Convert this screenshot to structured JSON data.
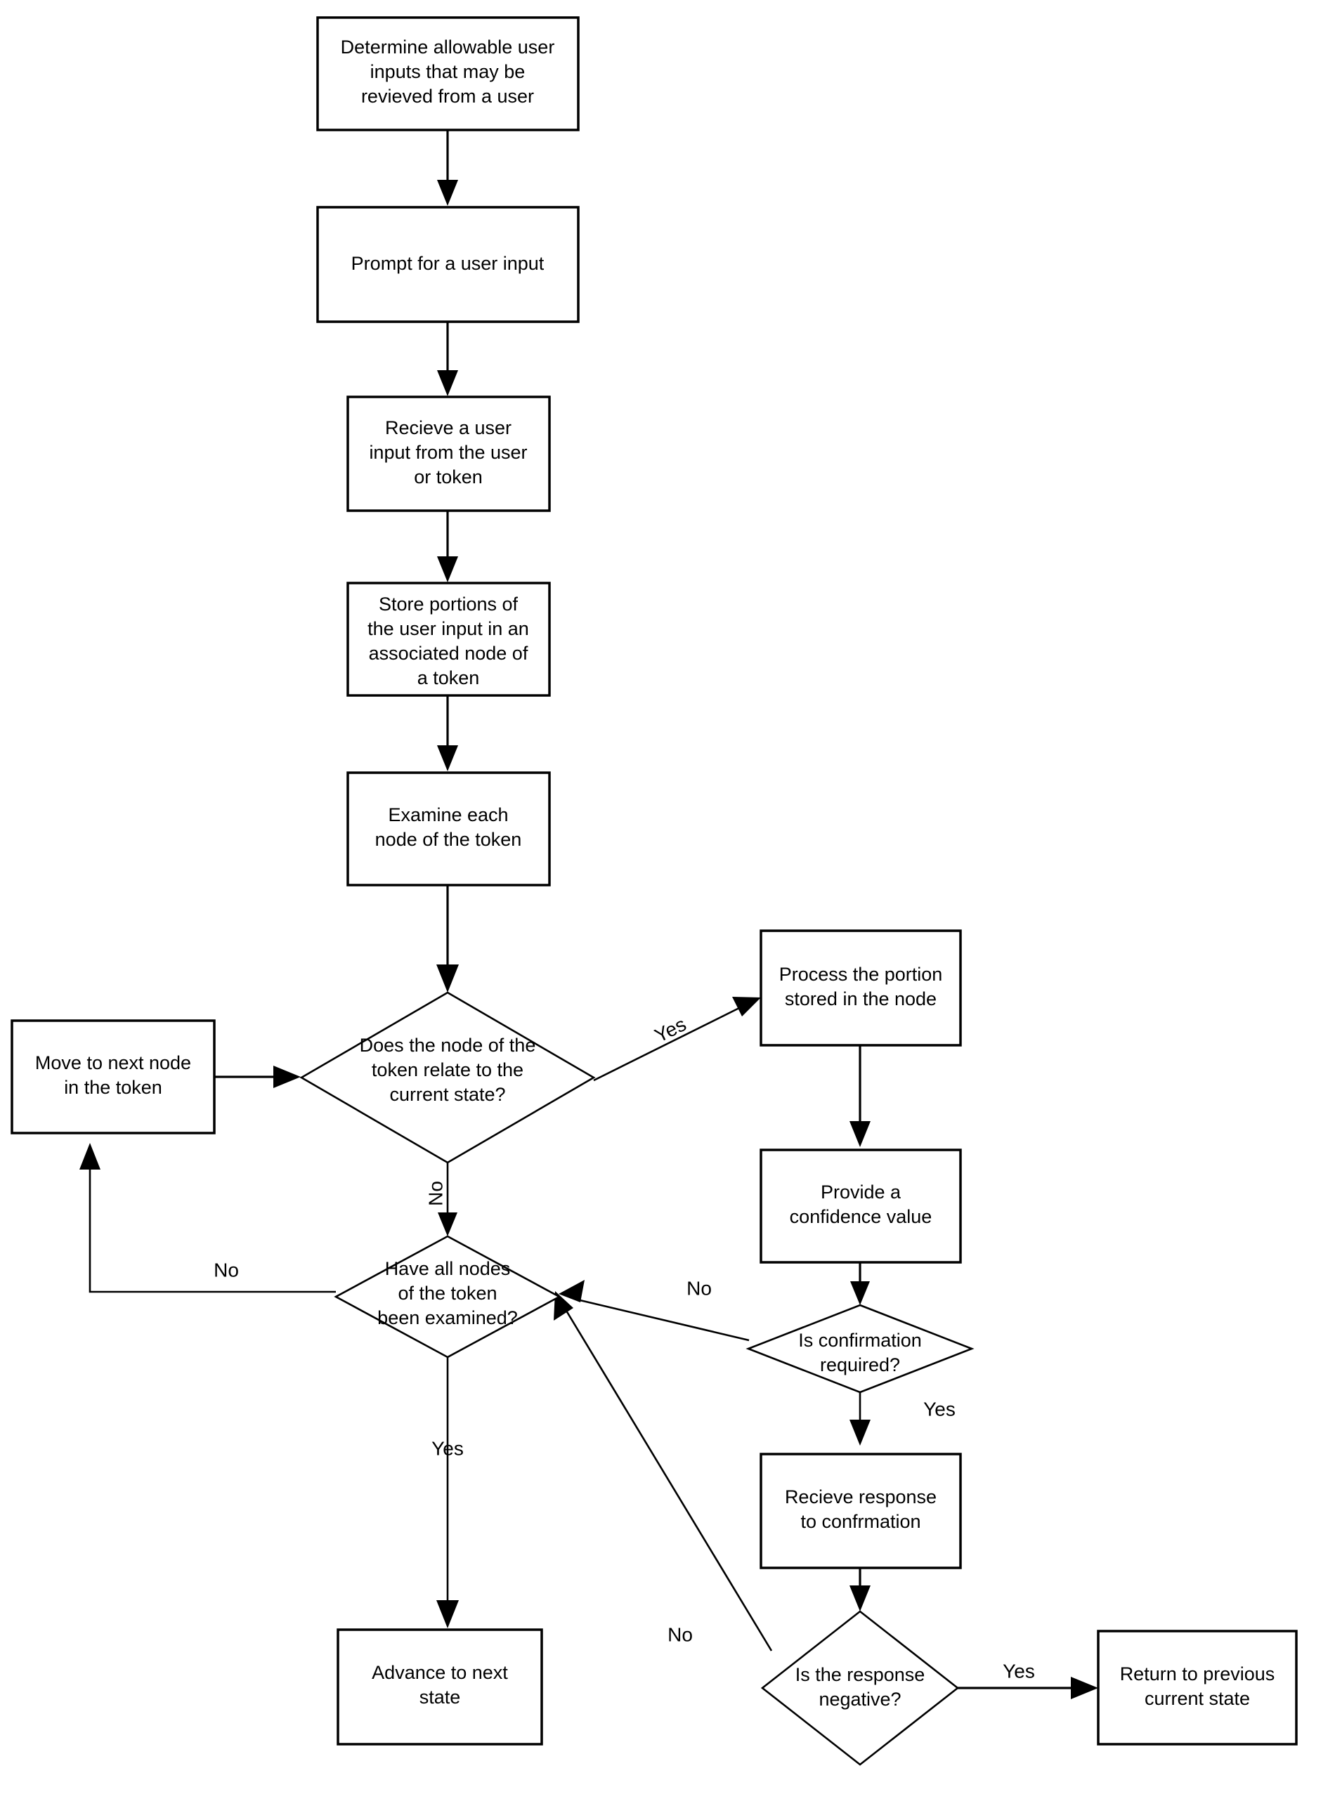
{
  "diagram": {
    "title": "User input token processing flowchart",
    "type": "flowchart",
    "stroke_color": "#000000",
    "fill_color": "#ffffff",
    "nodes": [
      {
        "id": "determine",
        "shape": "process",
        "lines": [
          "Determine allowable user",
          "inputs that may be",
          "revieved from a user"
        ]
      },
      {
        "id": "prompt",
        "shape": "process",
        "lines": [
          "Prompt for a user input"
        ]
      },
      {
        "id": "recieve_input",
        "shape": "process",
        "lines": [
          "Recieve a user",
          "input from the user",
          "or token"
        ]
      },
      {
        "id": "store_portions",
        "shape": "process",
        "lines": [
          "Store portions of",
          "the user input in an",
          "associated node of",
          "a token"
        ]
      },
      {
        "id": "examine",
        "shape": "process",
        "lines": [
          "Examine  each",
          "node of the token"
        ]
      },
      {
        "id": "relate_decision",
        "shape": "decision",
        "lines": [
          "Does the node of the",
          "token relate to the",
          "current state?"
        ]
      },
      {
        "id": "move_next_node",
        "shape": "process",
        "lines": [
          "Move to next node",
          "in the token"
        ]
      },
      {
        "id": "process_portion",
        "shape": "process",
        "lines": [
          "Process the portion",
          "stored in the node"
        ]
      },
      {
        "id": "confidence",
        "shape": "process",
        "lines": [
          "Provide a",
          "confidence value"
        ]
      },
      {
        "id": "all_nodes_decision",
        "shape": "decision",
        "lines": [
          "Have all nodes",
          "of the token",
          "been examined?"
        ]
      },
      {
        "id": "confirmation_decision",
        "shape": "decision",
        "lines": [
          "Is confirmation",
          "required?"
        ]
      },
      {
        "id": "recieve_response",
        "shape": "process",
        "lines": [
          "Recieve response",
          "to confrmation"
        ]
      },
      {
        "id": "advance_state",
        "shape": "process",
        "lines": [
          "Advance to next",
          "state"
        ]
      },
      {
        "id": "negative_decision",
        "shape": "decision",
        "lines": [
          "Is the response",
          "negative?"
        ]
      },
      {
        "id": "return_previous",
        "shape": "process",
        "lines": [
          "Return to previous",
          "current state"
        ]
      }
    ],
    "edge_labels": {
      "relate_yes": "Yes",
      "relate_no": "No",
      "all_nodes_no": "No",
      "all_nodes_yes": "Yes",
      "confirmation_no": "No",
      "confirmation_yes": "Yes",
      "negative_no": "No",
      "negative_yes": "Yes"
    },
    "edges": [
      {
        "from": "determine",
        "to": "prompt",
        "label": ""
      },
      {
        "from": "prompt",
        "to": "recieve_input",
        "label": ""
      },
      {
        "from": "recieve_input",
        "to": "store_portions",
        "label": ""
      },
      {
        "from": "store_portions",
        "to": "examine",
        "label": ""
      },
      {
        "from": "examine",
        "to": "relate_decision",
        "label": ""
      },
      {
        "from": "move_next_node",
        "to": "relate_decision",
        "label": ""
      },
      {
        "from": "relate_decision",
        "to": "process_portion",
        "label": "Yes"
      },
      {
        "from": "relate_decision",
        "to": "all_nodes_decision",
        "label": "No"
      },
      {
        "from": "process_portion",
        "to": "confidence",
        "label": ""
      },
      {
        "from": "confidence",
        "to": "confirmation_decision",
        "label": ""
      },
      {
        "from": "all_nodes_decision",
        "to": "move_next_node",
        "label": "No"
      },
      {
        "from": "all_nodes_decision",
        "to": "advance_state",
        "label": "Yes"
      },
      {
        "from": "confirmation_decision",
        "to": "all_nodes_decision",
        "label": "No"
      },
      {
        "from": "confirmation_decision",
        "to": "recieve_response",
        "label": "Yes"
      },
      {
        "from": "recieve_response",
        "to": "negative_decision",
        "label": ""
      },
      {
        "from": "negative_decision",
        "to": "all_nodes_decision",
        "label": "No"
      },
      {
        "from": "negative_decision",
        "to": "return_previous",
        "label": "Yes"
      }
    ]
  }
}
